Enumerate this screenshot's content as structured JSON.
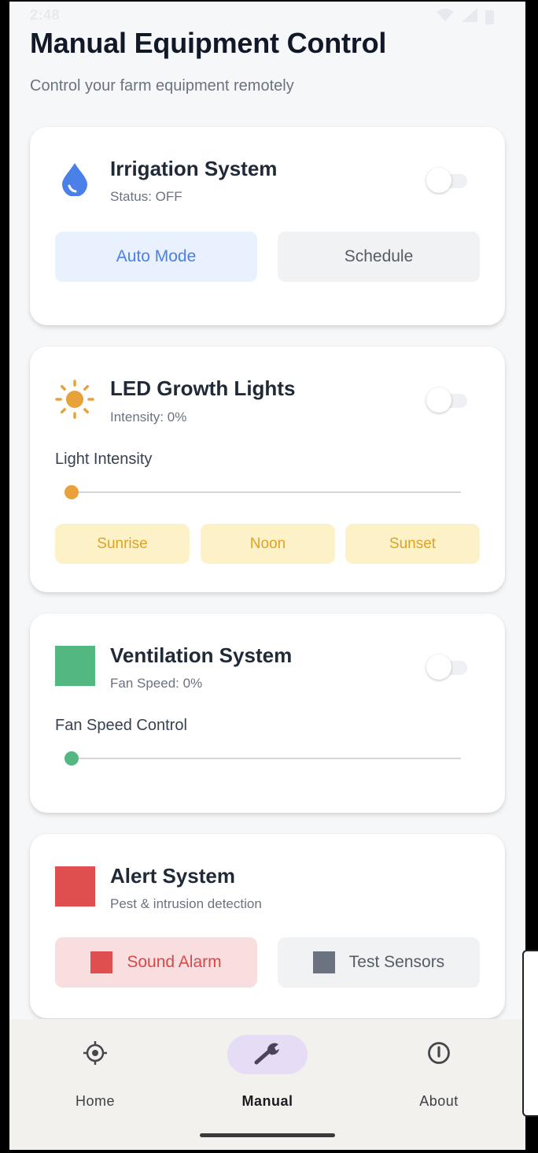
{
  "status_bar": {
    "time": "2:48"
  },
  "header": {
    "title": "Manual Equipment Control",
    "subtitle": "Control your farm equipment remotely"
  },
  "irrigation": {
    "title": "Irrigation System",
    "status": "Status: OFF",
    "toggle_on": false,
    "icon": "water-drop-icon",
    "auto_mode_label": "Auto Mode",
    "schedule_label": "Schedule"
  },
  "lights": {
    "title": "LED Growth Lights",
    "status": "Intensity: 0%",
    "toggle_on": false,
    "icon": "sun-icon",
    "slider_label": "Light Intensity",
    "slider_value": 0,
    "presets": [
      "Sunrise",
      "Noon",
      "Sunset"
    ]
  },
  "ventilation": {
    "title": "Ventilation System",
    "status": "Fan Speed: 0%",
    "toggle_on": false,
    "icon": "fan-square-icon",
    "slider_label": "Fan Speed Control",
    "slider_value": 0
  },
  "alert": {
    "title": "Alert System",
    "status": "Pest & intrusion detection",
    "icon": "alert-square-icon",
    "sound_alarm_label": "Sound Alarm",
    "test_sensors_label": "Test Sensors"
  },
  "nav": {
    "items": [
      {
        "label": "Home",
        "icon": "target-icon",
        "active": false
      },
      {
        "label": "Manual",
        "icon": "wrench-icon",
        "active": true
      },
      {
        "label": "About",
        "icon": "info-icon",
        "active": false
      }
    ]
  },
  "colors": {
    "blue_accent": "#4a80e8",
    "light_accent": "#e9a23b",
    "ventilation_green": "#52b780",
    "alert_red": "#e04f4f",
    "neutral_gray": "#6b7280"
  }
}
